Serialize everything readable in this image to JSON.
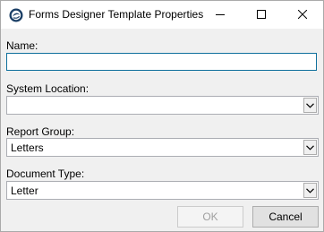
{
  "window": {
    "title": "Forms Designer Template Properties"
  },
  "caption_buttons": {
    "minimize_icon": "minimize-icon",
    "maximize_icon": "maximize-icon",
    "close_icon": "close-icon"
  },
  "form": {
    "name_label": "Name:",
    "name_value": "",
    "system_location_label": "System Location:",
    "system_location_value": "",
    "report_group_label": "Report Group:",
    "report_group_value": "Letters",
    "document_type_label": "Document Type:",
    "document_type_value": "Letter"
  },
  "buttons": {
    "ok_label": "OK",
    "ok_enabled": false,
    "cancel_label": "Cancel"
  },
  "colors": {
    "focus_border": "#0e6f9c",
    "dialog_background": "#f0f0f0",
    "disabled_text": "#a0a0a0"
  }
}
